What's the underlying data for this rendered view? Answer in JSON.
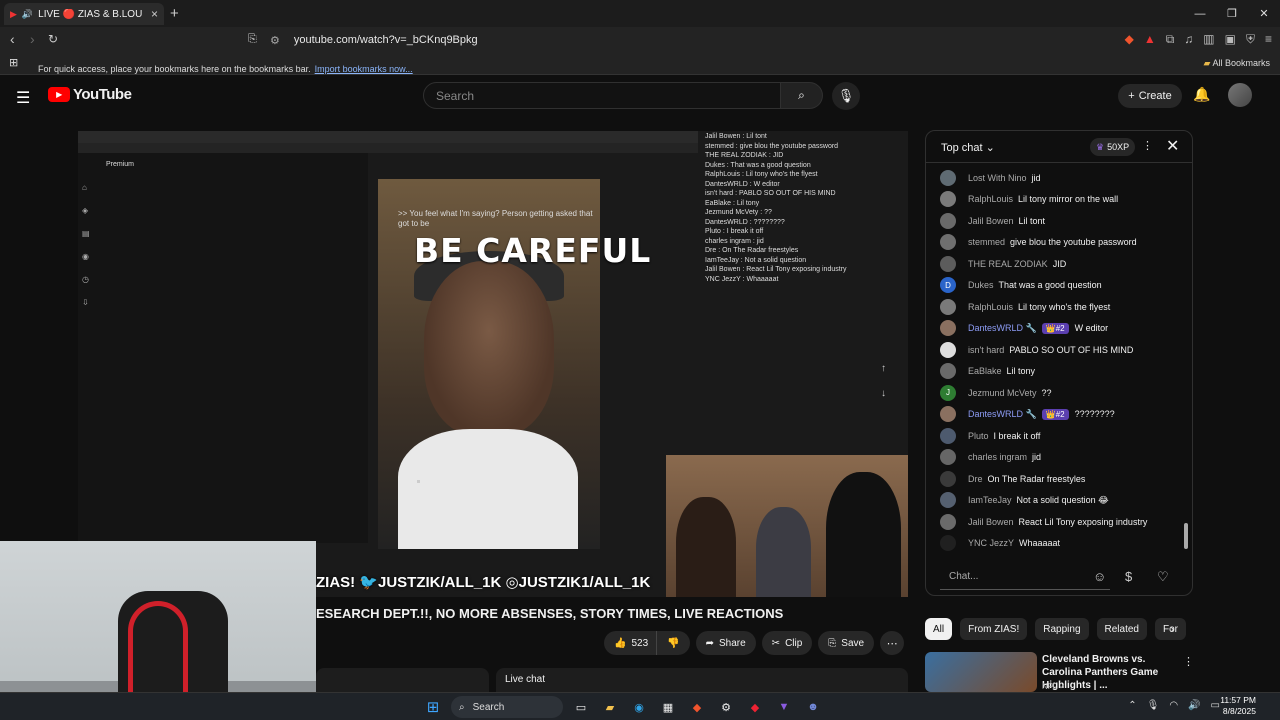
{
  "browser": {
    "tab_title": "LIVE 🔴 ZIAS & B.LOU II",
    "url": "youtube.com/watch?v=_bCKnq9Bpkg",
    "bookmarks_message": "For quick access, place your bookmarks here on the bookmarks bar.",
    "import_link": "Import bookmarks now...",
    "all_bookmarks": "All Bookmarks"
  },
  "youtube": {
    "logo_text": "YouTube",
    "search_placeholder": "Search",
    "create_label": "Create"
  },
  "video": {
    "overlay_text": "BE CAREFUL",
    "caption": ">> You feel what I'm saying? Person getting asked that got to be",
    "watermark": "ZIAS! 🐦JUSTZIK/ALL_1K ◎JUSTZIK1/ALL_1K",
    "title": "ESEARCH DEPT.!!, NO MORE ABSENSES, STORY TIMES, LIVE REACTIONS",
    "like_count": "523",
    "share_label": "Share",
    "clip_label": "Clip",
    "save_label": "Save",
    "premium_label": "Premium",
    "inner_chat": [
      "Jalil Bowen : Lil tont",
      "stemmed : give blou the youtube password",
      "THE REAL ZODIAK : JID",
      "Dukes : That was a good question",
      "RalphLouis : Lil tony who's the flyest",
      "DantesWRLD : W editor",
      "isn't hard : PABLO SO OUT OF HIS MIND",
      "EaBlake : Lil tony",
      "Jezmund McVety : ??",
      "DantesWRLD : ????????",
      "Pluto : I break it off",
      "charles ingram : jid",
      "Dre : On The Radar freestyles",
      "IamTeeJay : Not a solid question",
      "Jalil Bowen : React Lil Tony exposing industry",
      "YNC JezzY : Whaaaaat"
    ]
  },
  "below": {
    "live_chat_label": "Live chat"
  },
  "chat": {
    "header": "Top chat",
    "xp_label": "50XP",
    "input_placeholder": "Chat...",
    "messages": [
      {
        "author": "Lost With Nino",
        "text": "jid",
        "initial": "",
        "color": "#5f6b73",
        "badge": ""
      },
      {
        "author": "RalphLouis",
        "text": "Lil tony mirror on the wall",
        "initial": "",
        "color": "#7a7a7a",
        "badge": ""
      },
      {
        "author": "Jalil Bowen",
        "text": "Lil tont",
        "initial": "",
        "color": "#6a6a6a",
        "badge": ""
      },
      {
        "author": "stemmed",
        "text": "give blou the youtube password",
        "initial": "",
        "color": "#6f6f6f",
        "badge": ""
      },
      {
        "author": "THE REAL ZODIAK",
        "text": "JID",
        "initial": "",
        "color": "#5c5c5c",
        "badge": ""
      },
      {
        "author": "Dukes",
        "text": "That was a good question",
        "initial": "D",
        "color": "#2a64c9",
        "badge": ""
      },
      {
        "author": "RalphLouis",
        "text": "Lil tony who's the flyest",
        "initial": "",
        "color": "#7a7a7a",
        "badge": ""
      },
      {
        "author": "DantesWRLD 🔧",
        "text": "W editor",
        "initial": "",
        "color": "#8a7060",
        "badge": "👑#2"
      },
      {
        "author": "isn't hard",
        "text": "PABLO SO OUT OF HIS MIND",
        "initial": "",
        "color": "#dddddd",
        "badge": ""
      },
      {
        "author": "EaBlake",
        "text": "Lil tony",
        "initial": "",
        "color": "#6a6a6a",
        "badge": ""
      },
      {
        "author": "Jezmund McVety",
        "text": "??",
        "initial": "J",
        "color": "#2e7d32",
        "badge": ""
      },
      {
        "author": "DantesWRLD 🔧",
        "text": "????????",
        "initial": "",
        "color": "#8a7060",
        "badge": "👑#2"
      },
      {
        "author": "Pluto",
        "text": "I break it off",
        "initial": "",
        "color": "#4d5a6e",
        "badge": ""
      },
      {
        "author": "charles ingram",
        "text": "jid",
        "initial": "",
        "color": "#666666",
        "badge": ""
      },
      {
        "author": "Dre",
        "text": "On The Radar freestyles",
        "initial": "",
        "color": "#3a3a3a",
        "badge": ""
      },
      {
        "author": "IamTeeJay",
        "text": "Not a solid question 😂",
        "initial": "",
        "color": "#556070",
        "badge": ""
      },
      {
        "author": "Jalil Bowen",
        "text": "React Lil Tony exposing industry",
        "initial": "",
        "color": "#6a6a6a",
        "badge": ""
      },
      {
        "author": "YNC JezzY",
        "text": "Whaaaaat",
        "initial": "",
        "color": "#202020",
        "badge": ""
      }
    ]
  },
  "chips": [
    "All",
    "From ZIAS!",
    "Rapping",
    "Related",
    "For"
  ],
  "recommendation": {
    "title": "Cleveland Browns vs. Carolina Panthers Game Highlights | ...",
    "channel": "NFL ✓"
  },
  "taskbar": {
    "search_label": "Search",
    "time": "11:57 PM",
    "date": "8/8/2025"
  }
}
